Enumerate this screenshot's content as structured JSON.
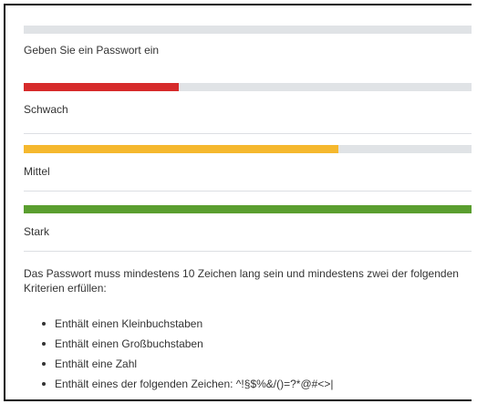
{
  "colors": {
    "empty": "#e0e3e6",
    "weak": "#d62b2b",
    "medium": "#f5b82e",
    "strong": "#5a9e2f"
  },
  "prompt": {
    "label": "Geben Sie ein Passwort ein",
    "fill": 0
  },
  "strength_levels": [
    {
      "label": "Schwach",
      "fill": 0.34
    },
    {
      "label": "Mittel",
      "fill": 0.69
    },
    {
      "label": "Stark",
      "fill": 1.0
    }
  ],
  "requirements": {
    "text": "Das Passwort muss mindestens 10 Zeichen lang sein und mindestens zwei der folgenden Kriterien erfüllen:",
    "items": [
      "Enthält einen Kleinbuchstaben",
      "Enthält einen Großbuchstaben",
      "Enthält eine Zahl",
      "Enthält eines der folgenden Zeichen: ^!§$%&/()=?*@#<>|"
    ]
  }
}
